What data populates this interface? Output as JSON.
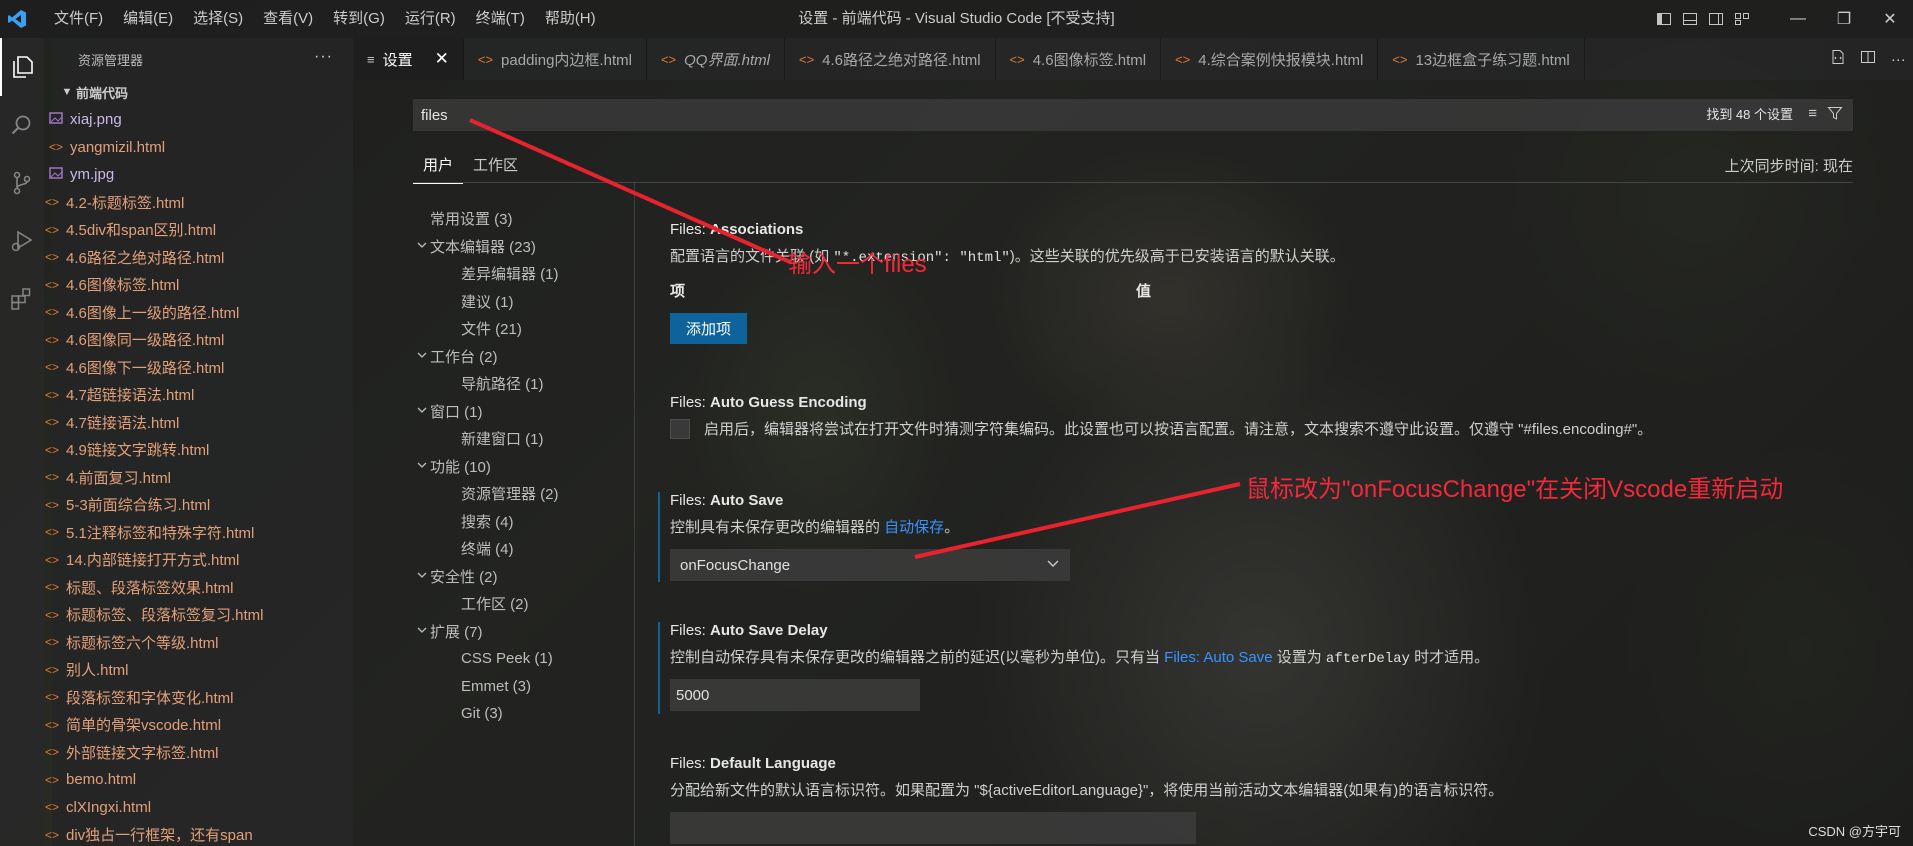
{
  "window": {
    "title": "设置 - 前端代码 - Visual Studio Code [不受支持]"
  },
  "menu": [
    "文件(F)",
    "编辑(E)",
    "选择(S)",
    "查看(V)",
    "转到(G)",
    "运行(R)",
    "终端(T)",
    "帮助(H)"
  ],
  "sidebar": {
    "header": "资源管理器",
    "folder": "前端代码",
    "files": [
      {
        "name": "xiaj.png",
        "type": "img"
      },
      {
        "name": "yangmizil.html",
        "type": "html-sub"
      },
      {
        "name": "ym.jpg",
        "type": "img"
      },
      {
        "name": "4.2-标题标签.html",
        "type": "html"
      },
      {
        "name": "4.5div和span区别.html",
        "type": "html"
      },
      {
        "name": "4.6路径之绝对路径.html",
        "type": "html"
      },
      {
        "name": "4.6图像标签.html",
        "type": "html"
      },
      {
        "name": "4.6图像上一级的路径.html",
        "type": "html"
      },
      {
        "name": "4.6图像同一级路径.html",
        "type": "html"
      },
      {
        "name": "4.6图像下一级路径.html",
        "type": "html"
      },
      {
        "name": "4.7超链接语法.html",
        "type": "html"
      },
      {
        "name": "4.7链接语法.html",
        "type": "html"
      },
      {
        "name": "4.9链接文字跳转.html",
        "type": "html"
      },
      {
        "name": "4.前面复习.html",
        "type": "html"
      },
      {
        "name": "5-3前面综合练习.html",
        "type": "html"
      },
      {
        "name": "5.1注释标签和特殊字符.html",
        "type": "html"
      },
      {
        "name": "14.内部链接打开方式.html",
        "type": "html"
      },
      {
        "name": "标题、段落标签效果.html",
        "type": "html"
      },
      {
        "name": "标题标签、段落标签复习.html",
        "type": "html"
      },
      {
        "name": "标题标签六个等级.html",
        "type": "html"
      },
      {
        "name": "别人.html",
        "type": "html"
      },
      {
        "name": "段落标签和字体变化.html",
        "type": "html"
      },
      {
        "name": "简单的骨架vscode.html",
        "type": "html"
      },
      {
        "name": "外部链接文字标签.html",
        "type": "html"
      },
      {
        "name": "bemo.html",
        "type": "html"
      },
      {
        "name": "clXIngxi.html",
        "type": "html"
      },
      {
        "name": "div独占一行框架，还有span",
        "type": "html"
      }
    ]
  },
  "tabs": [
    {
      "label": "设置",
      "active": true
    },
    {
      "label": "padding内边框.html"
    },
    {
      "label": "QQ界面.html",
      "italic": true
    },
    {
      "label": "4.6路径之绝对路径.html"
    },
    {
      "label": "4.6图像标签.html"
    },
    {
      "label": "4.综合案例快报模块.html"
    },
    {
      "label": "13边框盒子练习题.html"
    }
  ],
  "settings": {
    "search_value": "files",
    "result_count": "找到 48 个设置",
    "scope_tabs": [
      "用户",
      "工作区"
    ],
    "sync_time": "上次同步时间: 现在",
    "toc": [
      {
        "label": "常用设置 (3)",
        "level": 1
      },
      {
        "label": "文本编辑器 (23)",
        "level": 0
      },
      {
        "label": "差异编辑器 (1)",
        "level": 2
      },
      {
        "label": "建议 (1)",
        "level": 2
      },
      {
        "label": "文件 (21)",
        "level": 2
      },
      {
        "label": "工作台 (2)",
        "level": 0
      },
      {
        "label": "导航路径 (1)",
        "level": 2
      },
      {
        "label": "窗口 (1)",
        "level": 0
      },
      {
        "label": "新建窗口 (1)",
        "level": 2
      },
      {
        "label": "功能 (10)",
        "level": 0
      },
      {
        "label": "资源管理器 (2)",
        "level": 2
      },
      {
        "label": "搜索 (4)",
        "level": 2
      },
      {
        "label": "终端 (4)",
        "level": 2
      },
      {
        "label": "安全性 (2)",
        "level": 0
      },
      {
        "label": "工作区 (2)",
        "level": 2
      },
      {
        "label": "扩展 (7)",
        "level": 0
      },
      {
        "label": "CSS Peek (1)",
        "level": 2
      },
      {
        "label": "Emmet (3)",
        "level": 2
      },
      {
        "label": "Git (3)",
        "level": 2
      }
    ],
    "associations": {
      "prefix": "Files: ",
      "name": "Associations",
      "desc_before": "配置语言的文件关联 (如 ",
      "desc_code": "\"*.extension\": \"html\"",
      "desc_after": ")。这些关联的优先级高于已安装语言的默认关联。",
      "col_item": "项",
      "col_value": "值",
      "add_button": "添加项"
    },
    "auto_guess": {
      "prefix": "Files: ",
      "name": "Auto Guess Encoding",
      "desc": "启用后，编辑器将尝试在打开文件时猜测字符集编码。此设置也可以按语言配置。请注意，文本搜索不遵守此设置。仅遵守 \"#files.encoding#\"。"
    },
    "auto_save": {
      "prefix": "Files: ",
      "name": "Auto Save",
      "desc_before": "控制具有未保存更改的编辑器的 ",
      "desc_link": "自动保存",
      "desc_after": "。",
      "value": "onFocusChange"
    },
    "auto_save_delay": {
      "prefix": "Files: ",
      "name": "Auto Save Delay",
      "desc_before": "控制自动保存具有未保存更改的编辑器之前的延迟(以毫秒为单位)。只有当 ",
      "desc_link": "Files: Auto Save",
      "desc_mid": " 设置为 ",
      "desc_code": "afterDelay",
      "desc_after": " 时才适用。",
      "value": "5000"
    },
    "default_language": {
      "prefix": "Files: ",
      "name": "Default Language",
      "desc": "分配给新文件的默认语言标识符。如果配置为 \"${activeEditorLanguage}\"，将使用当前活动文本编辑器(如果有)的语言标识符。",
      "value": ""
    }
  },
  "annotations": {
    "search_note": "输入一个files",
    "autosave_note": "鼠标改为\"onFocusChange\"在关闭Vscode重新启动"
  },
  "watermark": "CSDN @方宇可",
  "colors": {
    "accent": "#0e639c",
    "link": "#3794ff",
    "annotation": "#f2293a",
    "file_html": "#e37933"
  }
}
